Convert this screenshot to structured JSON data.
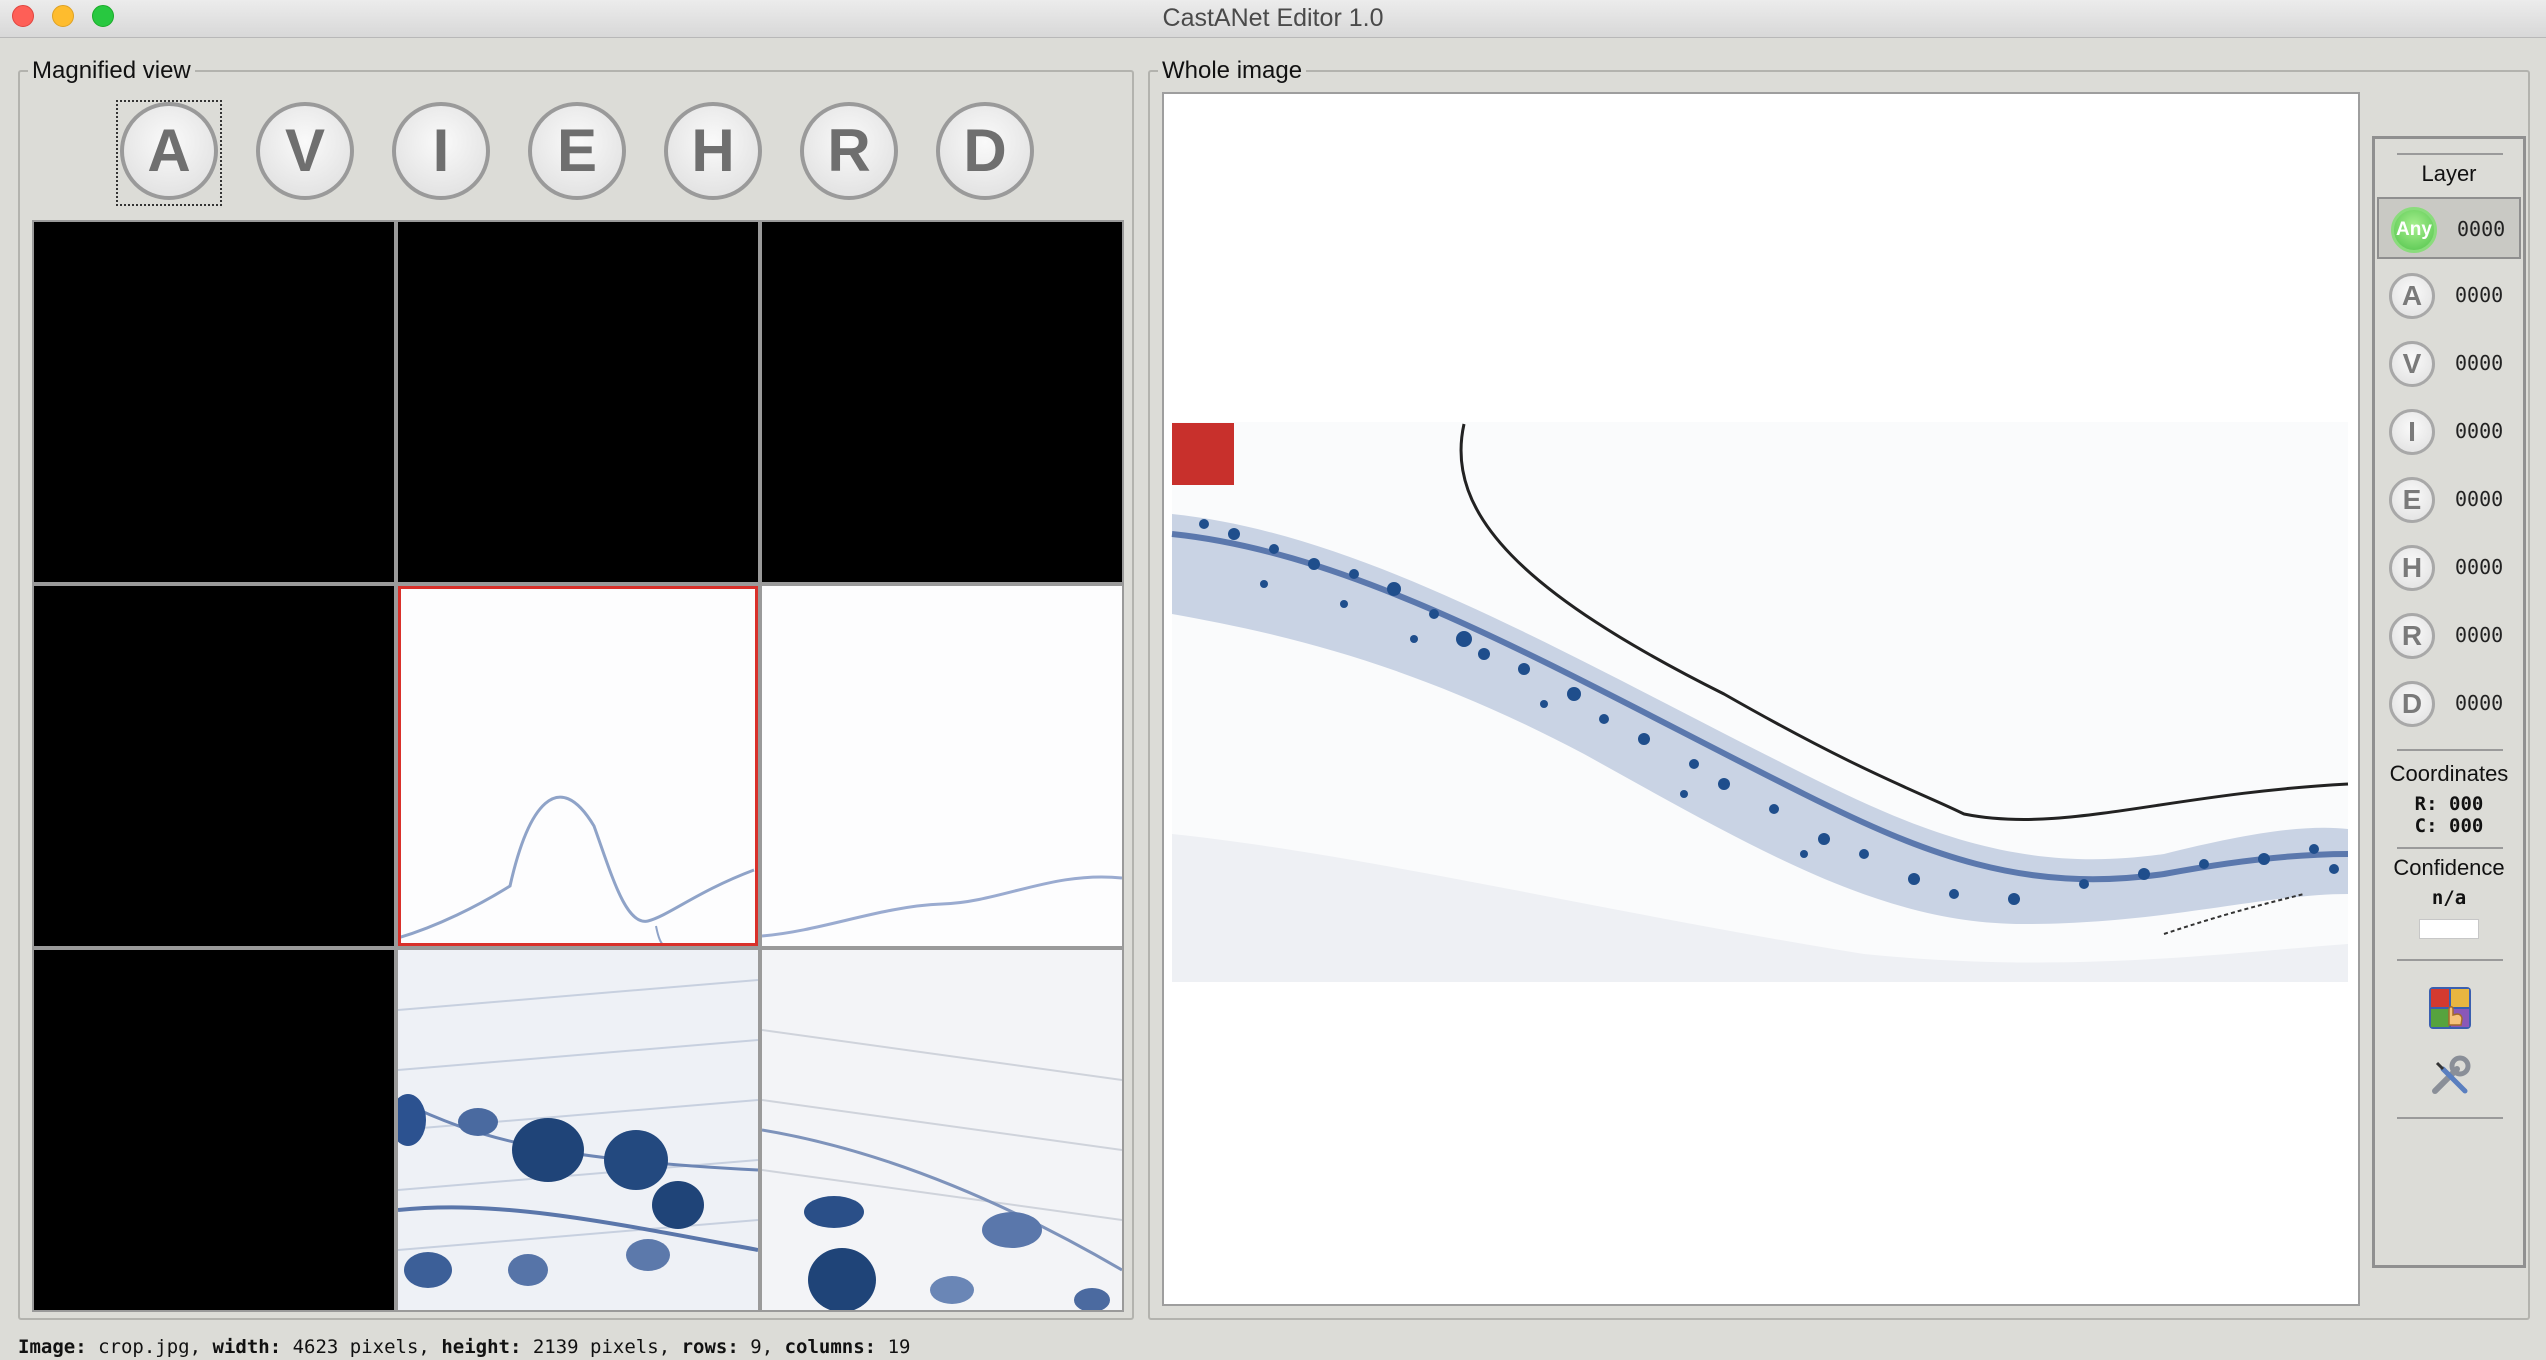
{
  "app": {
    "title": "CastANet Editor 1.0"
  },
  "magnified": {
    "label": "Magnified view",
    "buttons": [
      {
        "letter": "A",
        "icon": "A-circle-icon"
      },
      {
        "letter": "V",
        "icon": "V-circle-icon"
      },
      {
        "letter": "I",
        "icon": "I-circle-icon"
      },
      {
        "letter": "E",
        "icon": "E-circle-icon"
      },
      {
        "letter": "H",
        "icon": "H-circle-icon"
      },
      {
        "letter": "R",
        "icon": "R-circle-icon"
      },
      {
        "letter": "D",
        "icon": "D-circle-icon"
      }
    ]
  },
  "whole": {
    "label": "Whole image"
  },
  "side": {
    "layer_heading": "Layer",
    "layers": [
      {
        "label": "Any",
        "count": "0000"
      },
      {
        "label": "A",
        "count": "0000"
      },
      {
        "label": "V",
        "count": "0000"
      },
      {
        "label": "I",
        "count": "0000"
      },
      {
        "label": "E",
        "count": "0000"
      },
      {
        "label": "H",
        "count": "0000"
      },
      {
        "label": "R",
        "count": "0000"
      },
      {
        "label": "D",
        "count": "0000"
      }
    ],
    "coordinates_heading": "Coordinates",
    "row_label": "R:",
    "row_value": "000",
    "col_label": "C:",
    "col_value": "000",
    "confidence_heading": "Confidence",
    "confidence_value": "n/a",
    "tool_icons": [
      "color-palette-hand-icon",
      "wrench-screwdriver-icon"
    ]
  },
  "status": {
    "image_label": "Image:",
    "image_value": "crop.jpg,",
    "width_label": "width:",
    "width_value": "4623 pixels,",
    "height_label": "height:",
    "height_value": "2139 pixels,",
    "rows_label": "rows:",
    "rows_value": "9,",
    "columns_label": "columns:",
    "columns_value": "19"
  },
  "colors": {
    "window_bg": "#dcdcd7",
    "selection_red": "#d9302a",
    "stain_blue": "#1f4f8a",
    "any_green": "#4fc24a"
  }
}
